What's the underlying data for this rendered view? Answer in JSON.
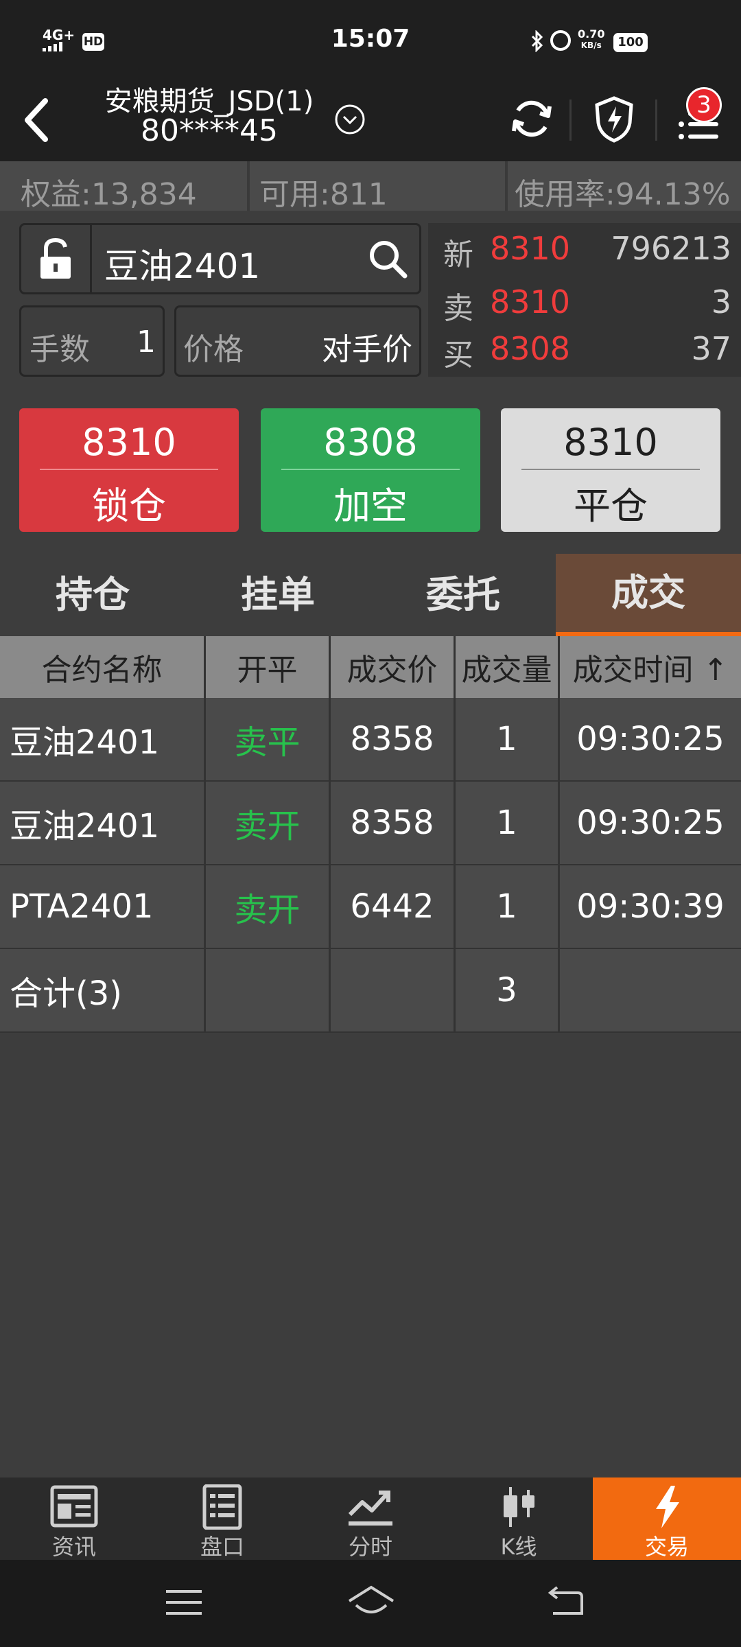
{
  "status_bar": {
    "signal": "4G+",
    "hd": "HD",
    "time": "15:07",
    "speed_value": "0.70",
    "speed_unit": "KB/s",
    "battery": "100"
  },
  "header": {
    "account_name": "安粮期货_JSD(1)",
    "account_number": "80****45",
    "notification_count": "3",
    "icons": [
      "back-arrow-icon",
      "chevron-down-icon",
      "refresh-icon",
      "shield-bolt-icon",
      "menu-icon"
    ]
  },
  "summary": {
    "equity": "权益:13,834",
    "available": "可用:811",
    "usage": "使用率:94.13%"
  },
  "order": {
    "symbol": "豆油2401",
    "qty_label": "手数",
    "qty_value": "1",
    "price_label": "价格",
    "price_value": "对手价"
  },
  "quote": {
    "last_label": "新",
    "last_price": "8310",
    "last_volume": "796213",
    "ask_label": "卖",
    "ask_price": "8310",
    "ask_volume": "3",
    "bid_label": "买",
    "bid_price": "8308",
    "bid_volume": "37"
  },
  "actions": {
    "lock": {
      "price": "8310",
      "label": "锁仓"
    },
    "short": {
      "price": "8308",
      "label": "加空"
    },
    "close": {
      "price": "8310",
      "label": "平仓"
    }
  },
  "tabs": [
    "持仓",
    "挂单",
    "委托",
    "成交"
  ],
  "table": {
    "headers": [
      "合约名称",
      "开平",
      "成交价",
      "成交量",
      "成交时间 ↑"
    ],
    "rows": [
      [
        "豆油2401",
        "卖平",
        "8358",
        "1",
        "09:30:25"
      ],
      [
        "豆油2401",
        "卖开",
        "8358",
        "1",
        "09:30:25"
      ],
      [
        "PTA2401",
        "卖开",
        "6442",
        "1",
        "09:30:39"
      ]
    ],
    "total": {
      "label": "合计(3)",
      "volume": "3"
    }
  },
  "bottom_nav": [
    {
      "label": "资讯",
      "icon": "news-icon"
    },
    {
      "label": "盘口",
      "icon": "orderbook-icon"
    },
    {
      "label": "分时",
      "icon": "intraday-chart-icon"
    },
    {
      "label": "K线",
      "icon": "candlestick-icon"
    },
    {
      "label": "交易",
      "icon": "lightning-icon"
    }
  ],
  "colors": {
    "up_red": "#f03c3c",
    "down_green": "#27c24c",
    "accent_orange": "#f26a10",
    "lock_button": "#d8393f",
    "short_button": "#2fa857",
    "close_button": "#dcdcdc"
  }
}
